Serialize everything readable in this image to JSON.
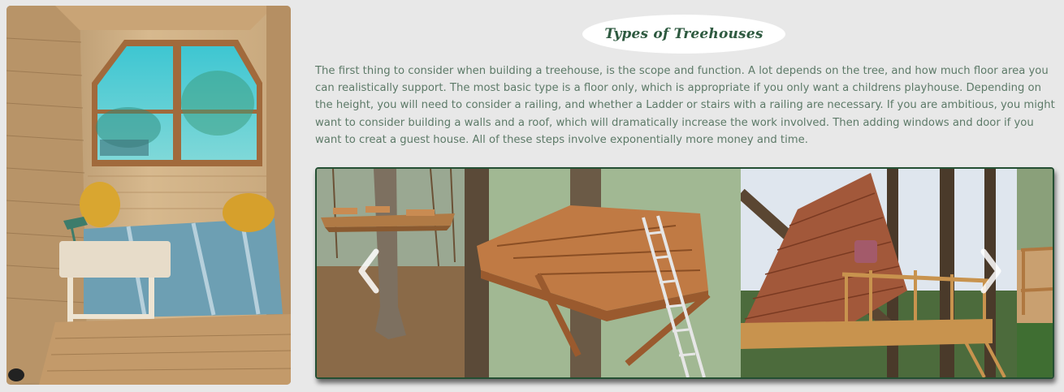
{
  "section": {
    "title": "Types of Treehouses",
    "intro": "The first thing to consider when building a treehouse, is the scope and function. A lot depends on the tree, and how much floor area you can realistically support. The most basic type is a floor only, which is appropriate if you only want a childrens playhouse. Depending on the height, you will need to consider a railing, and whether a Ladder or stairs with a railing are necessary. If you are ambitious, you might want to consider building a walls and a roof, which will dramatically increase the work involved. Then adding windows and door if you want to creat a guest house. All of these steps involve exponentially more money and time."
  },
  "carousel": {
    "prev_icon": "chevron-left-icon",
    "next_icon": "chevron-right-icon"
  },
  "colors": {
    "background": "#e8e8e8",
    "heading": "#2e5a40",
    "body_text": "#5d7a68",
    "carousel_border": "#244f33"
  }
}
